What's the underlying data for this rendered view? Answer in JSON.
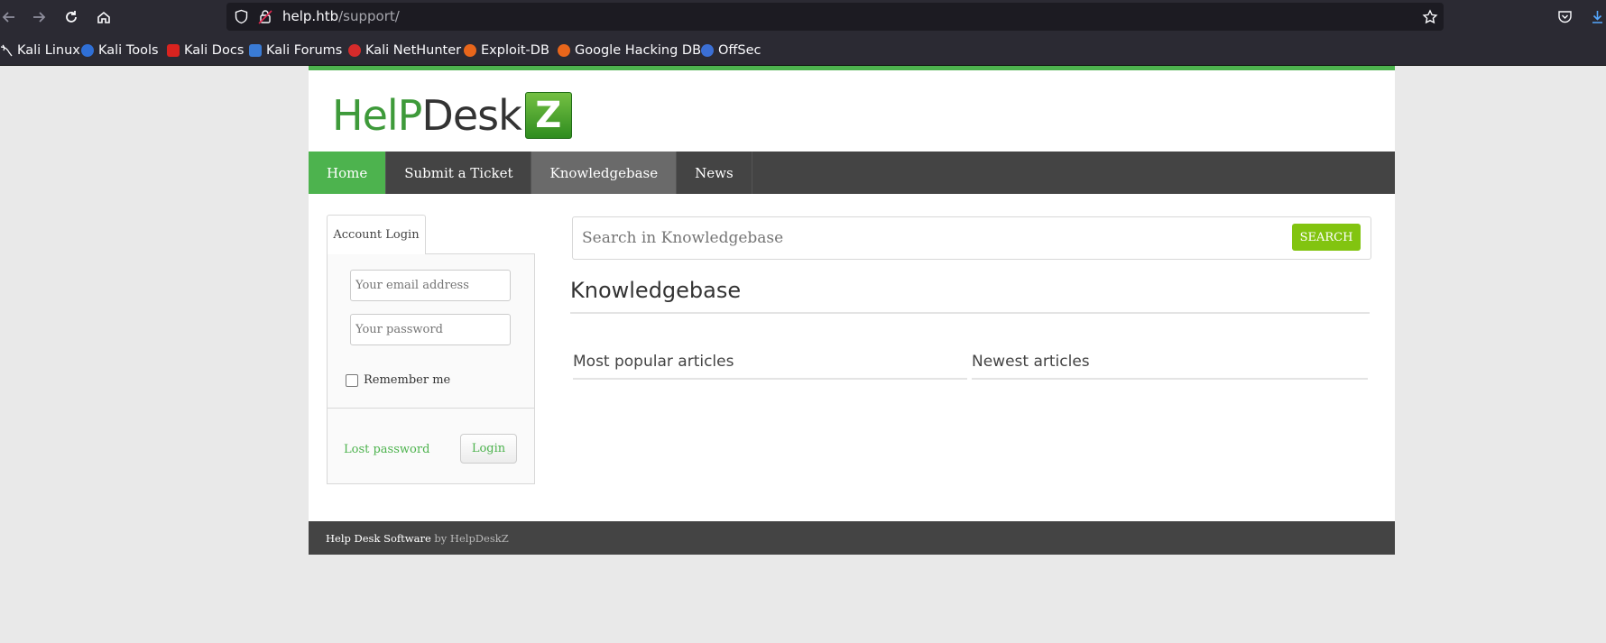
{
  "browser": {
    "url_host": "help.htb",
    "url_path": "/support/",
    "bookmarks": [
      {
        "label": "Kali Linux",
        "color": "#2b2a33"
      },
      {
        "label": "Kali Tools",
        "color": "#2f6fd6"
      },
      {
        "label": "Kali Docs",
        "color": "#d9231f"
      },
      {
        "label": "Kali Forums",
        "color": "#3a7bd5"
      },
      {
        "label": "Kali NetHunter",
        "color": "#d52b2b"
      },
      {
        "label": "Exploit-DB",
        "color": "#e8661b"
      },
      {
        "label": "Google Hacking DB",
        "color": "#e8661b"
      },
      {
        "label": "OffSec",
        "color": "#3b6fd4"
      }
    ]
  },
  "logo": {
    "part1": "HelP",
    "part2": "Desk",
    "badge": "Z"
  },
  "nav": {
    "items": [
      {
        "label": "Home"
      },
      {
        "label": "Submit a Ticket"
      },
      {
        "label": "Knowledgebase"
      },
      {
        "label": "News"
      }
    ]
  },
  "login": {
    "tab_label": "Account Login",
    "email_placeholder": "Your email address",
    "password_placeholder": "Your password",
    "remember_label": "Remember me",
    "lost_password": "Lost password",
    "login_button": "Login"
  },
  "kb": {
    "search_placeholder": "Search in Knowledgebase",
    "search_button": "SEARCH",
    "title": "Knowledgebase",
    "popular_title": "Most popular articles",
    "newest_title": "Newest articles"
  },
  "footer": {
    "software": "Help Desk Software",
    "by": "by HelpDeskZ"
  },
  "colors": {
    "accent_green": "#4db34e",
    "search_green": "#82c410",
    "nav_dark": "#444444"
  }
}
